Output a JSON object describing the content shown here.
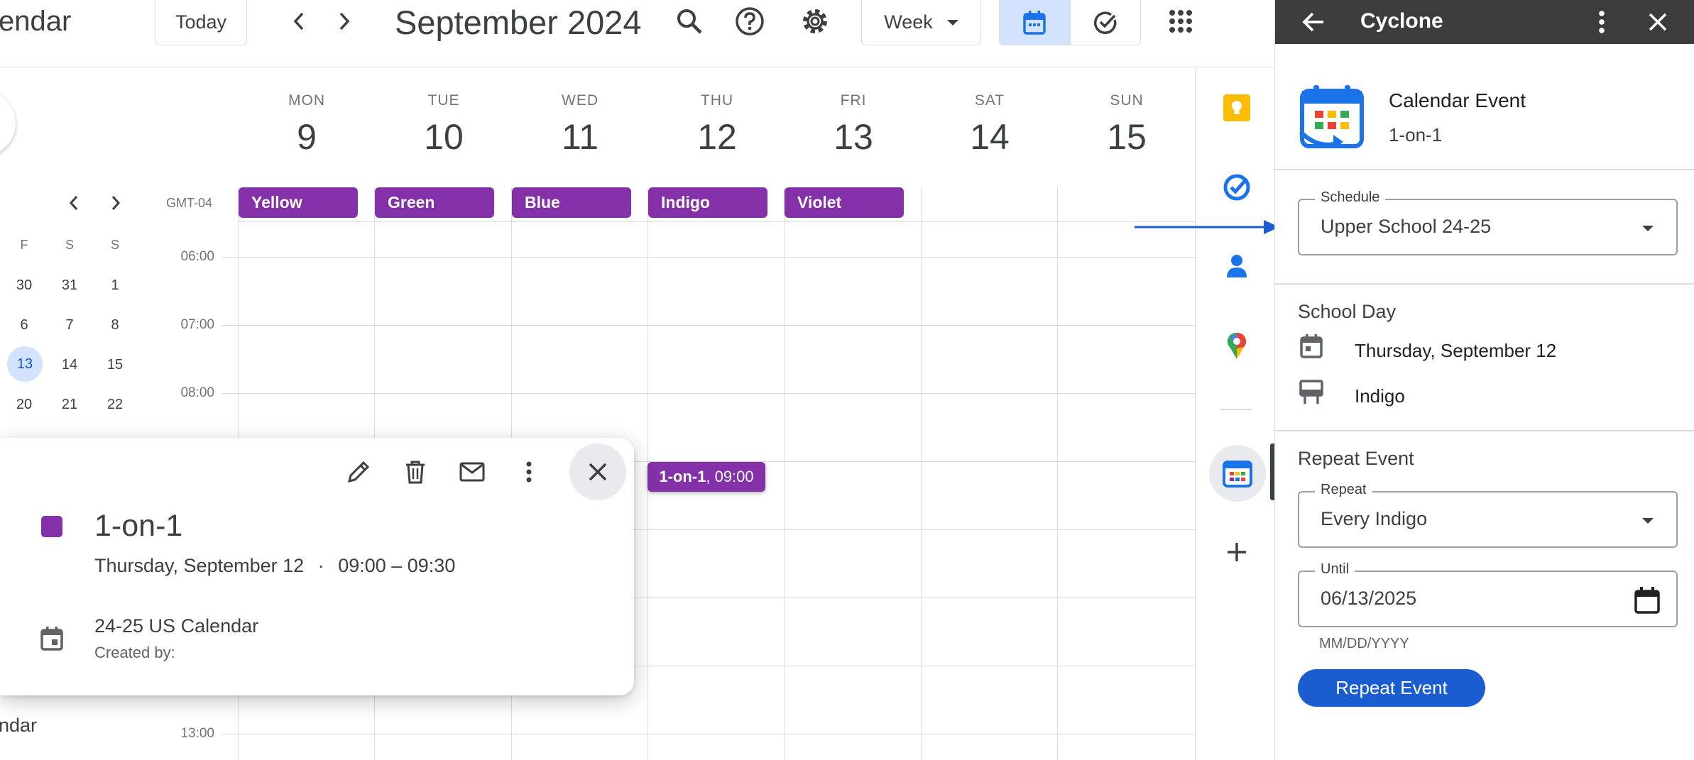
{
  "header": {
    "app_title": "endar",
    "today_label": "Today",
    "month_title": "September 2024",
    "view_label": "Week"
  },
  "week": {
    "days": [
      {
        "dow": "MON",
        "num": "9"
      },
      {
        "dow": "TUE",
        "num": "10"
      },
      {
        "dow": "WED",
        "num": "11"
      },
      {
        "dow": "THU",
        "num": "12"
      },
      {
        "dow": "FRI",
        "num": "13"
      },
      {
        "dow": "SAT",
        "num": "14"
      },
      {
        "dow": "SUN",
        "num": "15"
      }
    ],
    "timezone": "GMT-04",
    "all_day_chips": [
      "Yellow",
      "Green",
      "Blue",
      "Indigo",
      "Violet"
    ],
    "hours": [
      "06:00",
      "07:00",
      "08:00",
      "13:00"
    ]
  },
  "mini_calendar": {
    "headers": [
      "F",
      "S",
      "S"
    ],
    "rows": [
      [
        "30",
        "31",
        "1"
      ],
      [
        "6",
        "7",
        "8"
      ],
      [
        "13",
        "14",
        "15"
      ],
      [
        "20",
        "21",
        "22"
      ]
    ],
    "footer_label": "ndar"
  },
  "event_chip": {
    "title": "1-on-1",
    "time": "09:00"
  },
  "popover": {
    "title": "1-on-1",
    "date": "Thursday, September 12",
    "separator": "·",
    "time": "09:00 – 09:30",
    "calendar": "24-25 US Calendar",
    "created_by": "Created by:",
    "color": "#8430a8"
  },
  "panel": {
    "title": "Cyclone",
    "card_title": "Calendar Event",
    "card_subtitle": "1-on-1",
    "schedule_label": "Schedule",
    "schedule_value": "Upper School 24-25",
    "school_day_title": "School Day",
    "school_day_date": "Thursday, September 12",
    "school_day_block": "Indigo",
    "repeat_title": "Repeat Event",
    "repeat_label": "Repeat",
    "repeat_value": "Every Indigo",
    "until_label": "Until",
    "until_value": "06/13/2025",
    "until_hint": "MM/DD/YYYY",
    "repeat_button": "Repeat Event"
  },
  "colors": {
    "event_purple": "#8430a8",
    "primary_blue": "#1a5dd1",
    "panel_header": "#3c3c3c"
  }
}
